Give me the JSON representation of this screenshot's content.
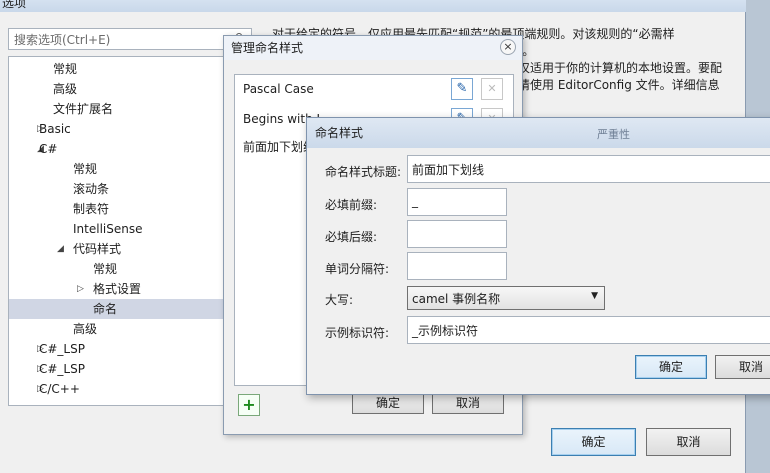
{
  "options": {
    "title": "选项",
    "search_placeholder": "搜索选项(Ctrl+E)",
    "tree": [
      {
        "label": "常规",
        "level": 2,
        "arrow": ""
      },
      {
        "label": "高级",
        "level": 2,
        "arrow": ""
      },
      {
        "label": "文件扩展名",
        "level": 2,
        "arrow": ""
      },
      {
        "label": "Basic",
        "level": 1,
        "arrow": "▷"
      },
      {
        "label": "C#",
        "level": 1,
        "arrow": "◢"
      },
      {
        "label": "常规",
        "level": 3,
        "arrow": ""
      },
      {
        "label": "滚动条",
        "level": 3,
        "arrow": ""
      },
      {
        "label": "制表符",
        "level": 3,
        "arrow": ""
      },
      {
        "label": "IntelliSense",
        "level": 3,
        "arrow": ""
      },
      {
        "label": "代码样式",
        "level": 2.5,
        "arrow": "◢"
      },
      {
        "label": "常规",
        "level": 4,
        "arrow": ""
      },
      {
        "label": "格式设置",
        "level": 3.5,
        "arrow": "▷"
      },
      {
        "label": "命名",
        "level": 4,
        "arrow": "",
        "selected": true
      },
      {
        "label": "高级",
        "level": 3,
        "arrow": ""
      },
      {
        "label": "C#_LSP",
        "level": 1,
        "arrow": "▷"
      },
      {
        "label": "C#_LSP",
        "level": 1,
        "arrow": "▷"
      },
      {
        "label": "C/C++",
        "level": 1,
        "arrow": "▷"
      }
    ],
    "desc_line1": "对于给定的符号，仅应用最先匹配“规范”的最顶端规则。对该规则的“必需样",
    "desc_line2": "式”。",
    "desc_line3": "仅适用于你的计算机的本地设置。要配",
    "desc_line4": "请使用 EditorConfig 文件。详细信息",
    "ok": "确定",
    "cancel": "取消"
  },
  "manage": {
    "title": "管理命名样式",
    "close_glyph": "×",
    "items": [
      {
        "label": "Pascal Case"
      },
      {
        "label": "Begins with I"
      },
      {
        "label": "前面加下划线"
      }
    ],
    "add_glyph": "+",
    "ok": "确定",
    "cancel": "取消"
  },
  "style": {
    "title": "命名样式",
    "title_ghost": "严重性",
    "fields": {
      "title_label": "命名样式标题:",
      "title_value": "前面加下划线",
      "prefix_label": "必填前缀:",
      "prefix_value": "_",
      "suffix_label": "必填后缀:",
      "suffix_value": "",
      "separator_label": "单词分隔符:",
      "separator_value": "",
      "case_label": "大写:",
      "case_value": "camel 事例名称",
      "sample_label": "示例标识符:",
      "sample_value": "_示例标识符"
    },
    "ok": "确定",
    "cancel": "取消"
  }
}
